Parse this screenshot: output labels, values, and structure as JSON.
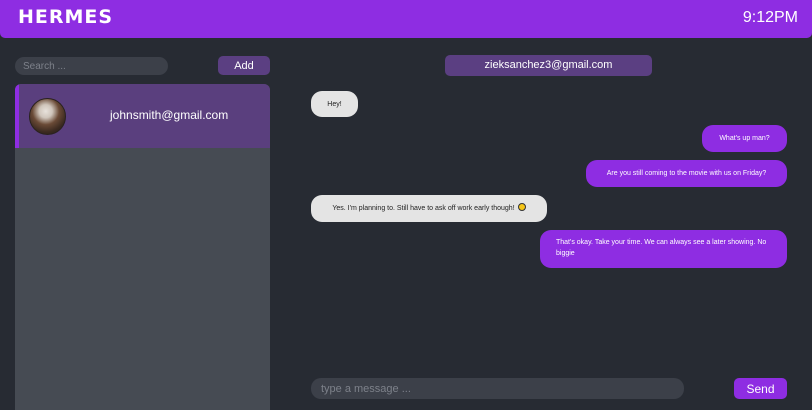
{
  "app": {
    "logo": "HERMES",
    "clock": "9:12PM"
  },
  "sidebar": {
    "search_placeholder": "Search ...",
    "add_label": "Add",
    "contacts": [
      {
        "email": "johnsmith@gmail.com",
        "selected": true
      }
    ]
  },
  "chat": {
    "recipient": "zieksanchez3@gmail.com",
    "messages": [
      {
        "direction": "incoming",
        "text": "Hey!"
      },
      {
        "direction": "outgoing",
        "text": "What's up man?"
      },
      {
        "direction": "outgoing",
        "text": "Are you still coming to the movie with us on Friday?"
      },
      {
        "direction": "incoming",
        "text": "Yes. I'm planning to. Still have to ask off work early though!",
        "emoji": "grimacing-face"
      },
      {
        "direction": "outgoing",
        "text": "That's okay. Take your time. We can always see a later showing. No biggie"
      }
    ],
    "input_placeholder": "type a message ...",
    "send_label": "Send"
  },
  "colors": {
    "accent": "#8e2de2",
    "accent_muted": "#5b3f82",
    "background": "#272b33",
    "panel": "#464b53",
    "incoming_bubble": "#e4e4e4"
  }
}
